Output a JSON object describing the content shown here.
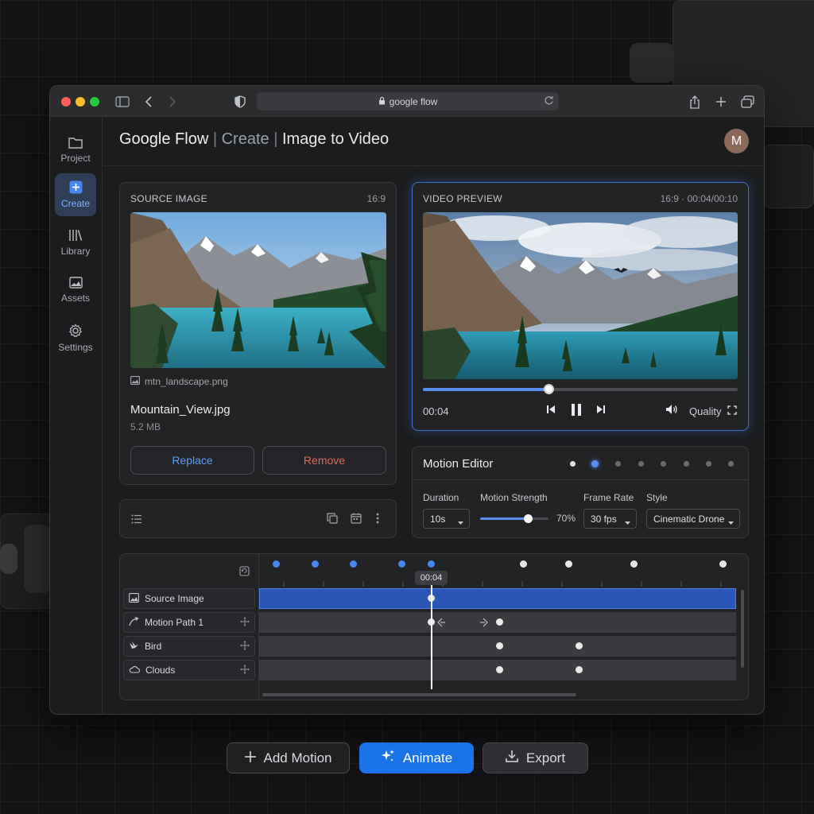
{
  "browser": {
    "url": "google flow"
  },
  "sidebar": {
    "items": [
      {
        "label": "Project",
        "icon": "folder-icon"
      },
      {
        "label": "Create",
        "icon": "plus-square-icon"
      },
      {
        "label": "Library",
        "icon": "library-icon"
      },
      {
        "label": "Assets",
        "icon": "image-icon"
      },
      {
        "label": "Settings",
        "icon": "gear-icon"
      }
    ]
  },
  "header": {
    "app": "Google Flow",
    "sep1": "|",
    "section": "Create",
    "sep2": "|",
    "page": "Image to Video",
    "avatar": "M"
  },
  "source": {
    "label": "SOURCE IMAGE",
    "ratio": "16:9",
    "filename": "mtn_landscape.png",
    "title": "Mountain_View.jpg",
    "size": "5.2 MB",
    "replace": "Replace",
    "remove": "Remove"
  },
  "preview": {
    "label": "VIDEO PREVIEW",
    "meta": "16:9 · 00:04/00:10",
    "time": "00:04",
    "quality": "Quality",
    "progress": 0.4
  },
  "motion": {
    "title": "Motion Editor",
    "duration_label": "Duration",
    "duration_value": "10s",
    "strength_label": "Motion Strength",
    "strength_value": "70%",
    "strength": 0.7,
    "fps_label": "Frame Rate",
    "fps_value": "30 fps",
    "style_label": "Style",
    "style_value": "Cinematic Drone"
  },
  "timeline": {
    "playhead": "00:04",
    "tracks": [
      {
        "label": "Source Image",
        "icon": "image-icon"
      },
      {
        "label": "Motion Path 1",
        "icon": "path-icon"
      },
      {
        "label": "Bird",
        "icon": "bird-icon"
      },
      {
        "label": "Clouds",
        "icon": "cloud-icon"
      }
    ]
  },
  "actions": {
    "add_motion": "Add Motion",
    "animate": "Animate",
    "export": "Export"
  },
  "colors": {
    "accent": "#1a73e8",
    "accent_light": "#4a86f0",
    "remove": "#e0675a"
  }
}
